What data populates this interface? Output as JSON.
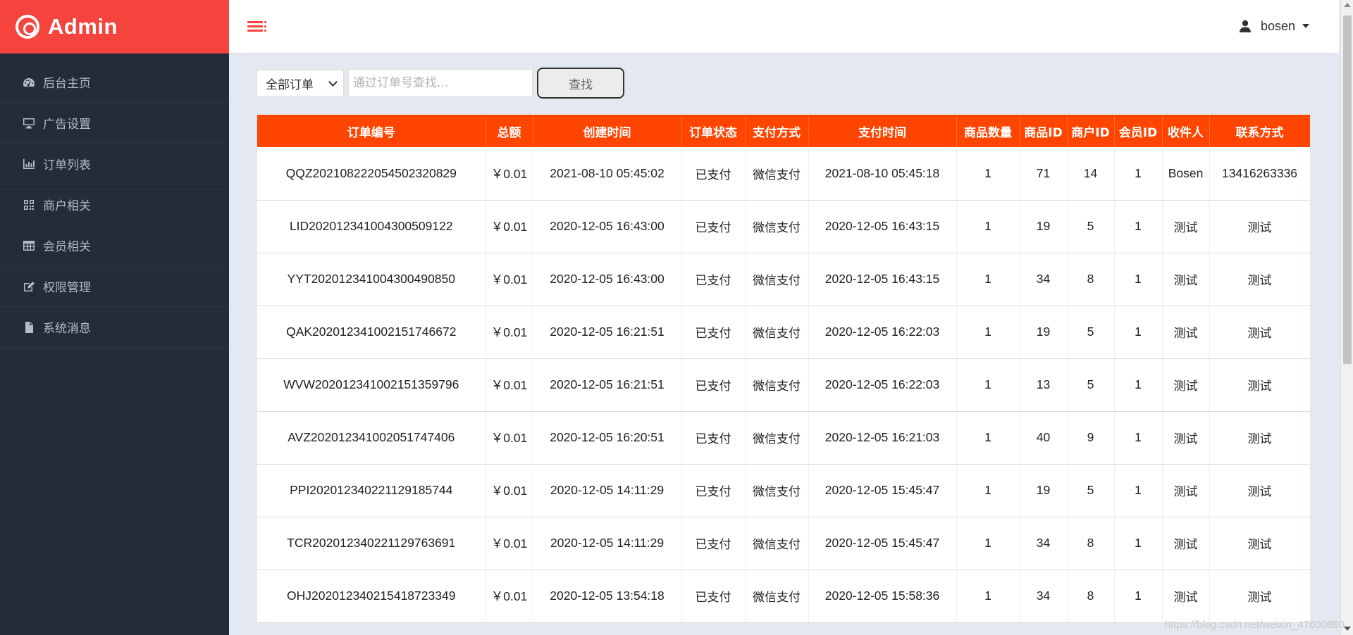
{
  "brand": {
    "title": "Admin"
  },
  "sidebar": {
    "items": [
      {
        "label": "后台主页",
        "icon": "dashboard-icon"
      },
      {
        "label": "广告设置",
        "icon": "desktop-icon"
      },
      {
        "label": "订单列表",
        "icon": "bar-chart-icon"
      },
      {
        "label": "商户相关",
        "icon": "qrcode-icon"
      },
      {
        "label": "会员相关",
        "icon": "table-icon"
      },
      {
        "label": "权限管理",
        "icon": "edit-icon"
      },
      {
        "label": "系统消息",
        "icon": "file-icon"
      }
    ]
  },
  "header": {
    "username": "bosen"
  },
  "search": {
    "filter_selected": "全部订单",
    "placeholder": "通过订单号查找...",
    "button": "查找"
  },
  "table": {
    "columns": [
      "订单编号",
      "总额",
      "创建时间",
      "订单状态",
      "支付方式",
      "支付时间",
      "商品数量",
      "商品ID",
      "商户ID",
      "会员ID",
      "收件人",
      "联系方式"
    ],
    "rows": [
      [
        "QQZ202108222054502320829",
        "￥0.01",
        "2021-08-10 05:45:02",
        "已支付",
        "微信支付",
        "2021-08-10 05:45:18",
        "1",
        "71",
        "14",
        "1",
        "Bosen",
        "13416263336"
      ],
      [
        "LID202012341004300509122",
        "￥0.01",
        "2020-12-05 16:43:00",
        "已支付",
        "微信支付",
        "2020-12-05 16:43:15",
        "1",
        "19",
        "5",
        "1",
        "测试",
        "测试"
      ],
      [
        "YYT202012341004300490850",
        "￥0.01",
        "2020-12-05 16:43:00",
        "已支付",
        "微信支付",
        "2020-12-05 16:43:15",
        "1",
        "34",
        "8",
        "1",
        "测试",
        "测试"
      ],
      [
        "QAK202012341002151746672",
        "￥0.01",
        "2020-12-05 16:21:51",
        "已支付",
        "微信支付",
        "2020-12-05 16:22:03",
        "1",
        "19",
        "5",
        "1",
        "测试",
        "测试"
      ],
      [
        "WVW202012341002151359796",
        "￥0.01",
        "2020-12-05 16:21:51",
        "已支付",
        "微信支付",
        "2020-12-05 16:22:03",
        "1",
        "13",
        "5",
        "1",
        "测试",
        "测试"
      ],
      [
        "AVZ202012341002051747406",
        "￥0.01",
        "2020-12-05 16:20:51",
        "已支付",
        "微信支付",
        "2020-12-05 16:21:03",
        "1",
        "40",
        "9",
        "1",
        "测试",
        "测试"
      ],
      [
        "PPI202012340221129185744",
        "￥0.01",
        "2020-12-05 14:11:29",
        "已支付",
        "微信支付",
        "2020-12-05 15:45:47",
        "1",
        "19",
        "5",
        "1",
        "测试",
        "测试"
      ],
      [
        "TCR202012340221129763691",
        "￥0.01",
        "2020-12-05 14:11:29",
        "已支付",
        "微信支付",
        "2020-12-05 15:45:47",
        "1",
        "34",
        "8",
        "1",
        "测试",
        "测试"
      ],
      [
        "OHJ202012340215418723349",
        "￥0.01",
        "2020-12-05 13:54:18",
        "已支付",
        "微信支付",
        "2020-12-05 15:58:36",
        "1",
        "34",
        "8",
        "1",
        "测试",
        "测试"
      ]
    ]
  },
  "watermark": "https://blog.csdn.net/weixin_47600880",
  "colors": {
    "brand_red": "#f5443d",
    "table_header": "#ff4500",
    "sidebar_bg": "#232c39",
    "page_bg": "#e4e8f0"
  }
}
